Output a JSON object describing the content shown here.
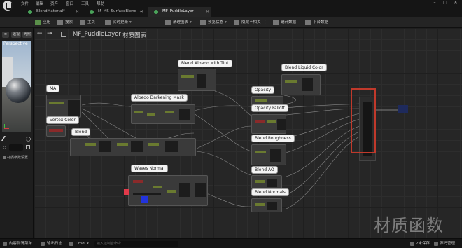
{
  "menu": {
    "items": [
      "文件",
      "编辑",
      "资产",
      "窗口",
      "工具",
      "帮助"
    ]
  },
  "tabs": [
    {
      "label": "BlendMaterial*",
      "active": false,
      "icon_color": "#4aa35a"
    },
    {
      "label": "M_MS_SurfaceBlend_...",
      "active": false,
      "icon_color": "#4aa35a"
    },
    {
      "label": "MF_PuddleLayer",
      "active": true,
      "icon_color": "#4aa35a"
    }
  ],
  "toolbar": {
    "items": [
      {
        "label": "应用",
        "icon": "apply-icon"
      },
      {
        "label": "搜索",
        "icon": "search-icon"
      },
      {
        "label": "主页",
        "icon": "home-icon"
      },
      {
        "label": "实时更新",
        "icon": "live-update-icon"
      },
      {
        "label": "清理图表",
        "icon": "clean-graph-icon"
      },
      {
        "label": "预览状态",
        "icon": "preview-state-icon"
      },
      {
        "label": "隐藏不相关",
        "icon": "hide-unrelated-icon"
      },
      {
        "label": "统计数据",
        "icon": "stats-icon"
      },
      {
        "label": "平台数据",
        "icon": "platform-stats-icon"
      }
    ]
  },
  "left_panel": {
    "top_buttons": [
      "透视",
      "光照"
    ],
    "viewport_label": "Perspective",
    "param_label": "材质参数设置"
  },
  "graph": {
    "breadcrumb": {
      "asset": "MF_PuddleLayer",
      "section": "材质图表"
    },
    "comments": [
      "MA",
      "Vertex Color",
      "Blend",
      "Blend Albedo with Tint",
      "Albedo Darkening Mask",
      "Waves Normal",
      "Blend Liquid Color",
      "Opacity",
      "Opacity Falloff",
      "Blend Roughness",
      "Blend AO",
      "Blend Normals"
    ],
    "watermark": "材质函数",
    "accent_color": "#c0392b"
  },
  "status_bar": {
    "content_drawer": "内容侧滑菜单",
    "output_log": "输出日志",
    "cmd": "Cmd",
    "cmd_placeholder": "输入控制台命令",
    "unsaved": "2未保存",
    "source_control": "源码管理"
  }
}
